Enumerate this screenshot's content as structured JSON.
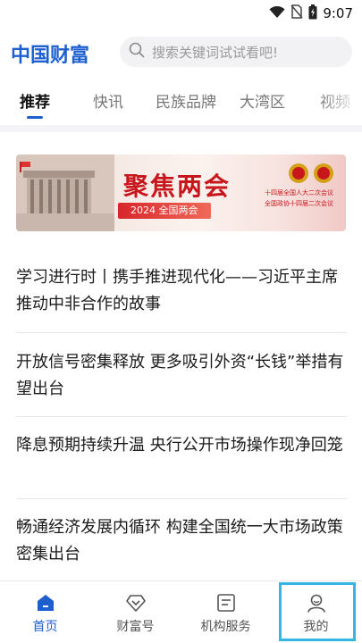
{
  "status_bar": {
    "time": "9:07",
    "icons": [
      "wifi-icon",
      "no-sim-icon",
      "battery-icon"
    ]
  },
  "header": {
    "logo_text": "中国财富",
    "search": {
      "placeholder": "搜索关键词试试看吧!"
    }
  },
  "tabs": [
    {
      "label": "推荐",
      "active": true
    },
    {
      "label": "快讯",
      "active": false
    },
    {
      "label": "民族品牌",
      "active": false
    },
    {
      "label": "大湾区",
      "active": false
    },
    {
      "label": "视频",
      "active": false
    }
  ],
  "banner": {
    "title": "聚焦两会",
    "tag": "2024 全国两会",
    "sub_line_1": "十四届全国人大二次会议",
    "sub_line_2": "全国政协十四届二次会议"
  },
  "articles": [
    {
      "title": "学习进行时丨携手推进现代化——习近平主席推动中非合作的故事"
    },
    {
      "title": "开放信号密集释放 更多吸引外资“长钱”举措有望出台"
    },
    {
      "title": "降息预期持续升温 央行公开市场操作现净回笼"
    },
    {
      "title": "畅通经济发展内循环 构建全国统一大市场政策密集出台"
    }
  ],
  "bottom_nav": [
    {
      "label": "首页",
      "icon": "home-icon",
      "active": true
    },
    {
      "label": "财富号",
      "icon": "diamond-icon",
      "active": false
    },
    {
      "label": "机构服务",
      "icon": "document-icon",
      "active": false
    },
    {
      "label": "我的",
      "icon": "user-icon",
      "active": false,
      "highlighted": true
    }
  ],
  "colors": {
    "brand_blue": "#1e5fd0",
    "banner_red": "#c8161d",
    "highlight_cyan": "#33b8e6"
  }
}
